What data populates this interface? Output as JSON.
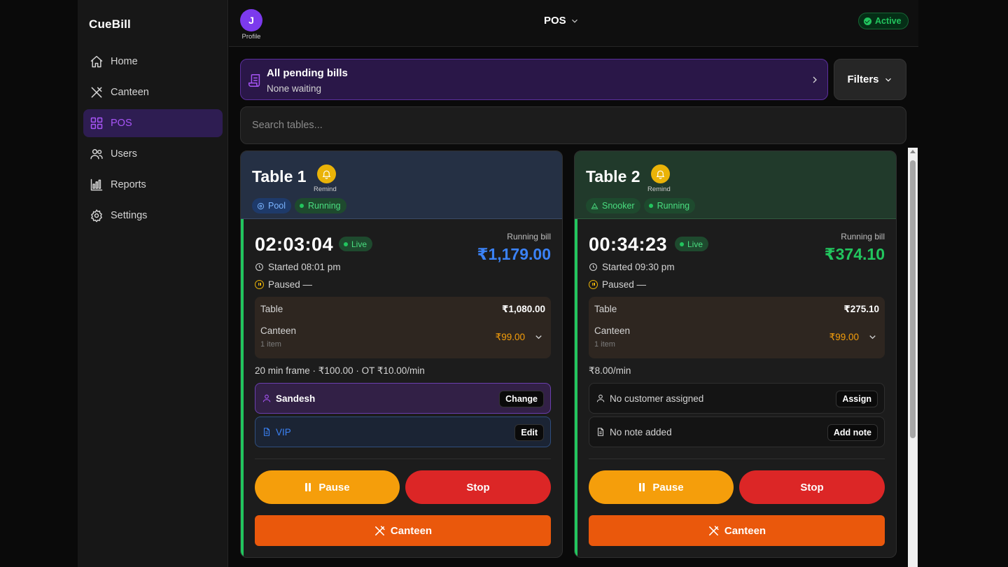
{
  "app": {
    "brand": "CueBill"
  },
  "sidebar": {
    "items": [
      {
        "label": "Home",
        "icon": "home-icon"
      },
      {
        "label": "Canteen",
        "icon": "utensils-icon"
      },
      {
        "label": "POS",
        "icon": "grid-icon",
        "active": true
      },
      {
        "label": "Users",
        "icon": "users-icon"
      },
      {
        "label": "Reports",
        "icon": "bar-chart-icon"
      },
      {
        "label": "Settings",
        "icon": "gear-icon"
      }
    ]
  },
  "header": {
    "avatar_initial": "J",
    "profile_label": "Profile",
    "title": "POS",
    "status": "Active"
  },
  "pending": {
    "title": "All pending bills",
    "subtitle": "None waiting"
  },
  "filters_label": "Filters",
  "search": {
    "placeholder": "Search tables..."
  },
  "colors": {
    "accent_purple": "#a855f7",
    "live_green": "#22c55e",
    "pool_blue": "#3b82f6",
    "canteen_orange": "#ea580c",
    "pause_amber": "#f59e0b",
    "stop_red": "#dc2626"
  },
  "tables": [
    {
      "name": "Table 1",
      "remind_label": "Remind",
      "type": "Pool",
      "status": "Running",
      "timer": "02:03:04",
      "live_label": "Live",
      "running_bill_label": "Running bill",
      "running_bill": "₹1,179.00",
      "started": "Started 08:01 pm",
      "paused": "Paused —",
      "table_label": "Table",
      "table_amount": "₹1,080.00",
      "canteen_label": "Canteen",
      "canteen_items": "1 item",
      "canteen_amount": "₹99.00",
      "rate": "20 min frame · ₹100.00 · OT ₹10.00/min",
      "customer": "Sandesh",
      "customer_action": "Change",
      "note": "VIP",
      "note_action": "Edit",
      "pause_label": "Pause",
      "stop_label": "Stop",
      "canteen_button": "Canteen"
    },
    {
      "name": "Table 2",
      "remind_label": "Remind",
      "type": "Snooker",
      "status": "Running",
      "timer": "00:34:23",
      "live_label": "Live",
      "running_bill_label": "Running bill",
      "running_bill": "₹374.10",
      "started": "Started 09:30 pm",
      "paused": "Paused —",
      "table_label": "Table",
      "table_amount": "₹275.10",
      "canteen_label": "Canteen",
      "canteen_items": "1 item",
      "canteen_amount": "₹99.00",
      "rate": "₹8.00/min",
      "customer": "No customer assigned",
      "customer_action": "Assign",
      "note": "No note added",
      "note_action": "Add note",
      "pause_label": "Pause",
      "stop_label": "Stop",
      "canteen_button": "Canteen"
    }
  ]
}
